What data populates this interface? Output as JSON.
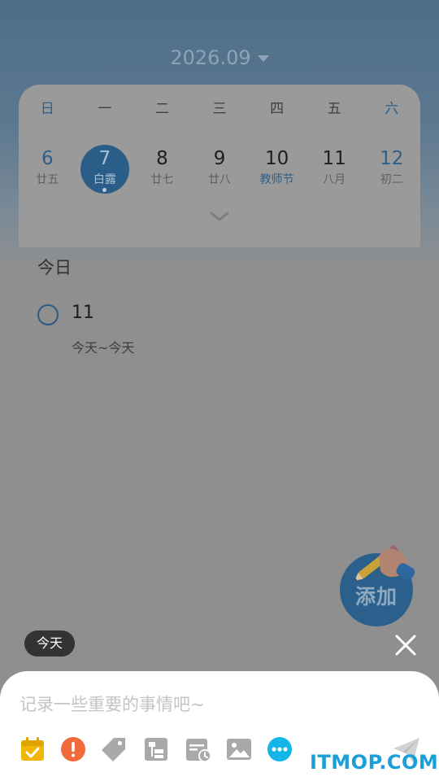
{
  "header": {
    "month": "2026.09"
  },
  "calendar": {
    "weekdays": [
      "日",
      "一",
      "二",
      "三",
      "四",
      "五",
      "六"
    ],
    "days": [
      {
        "num": "6",
        "lunar": "廿五"
      },
      {
        "num": "7",
        "lunar": "白露"
      },
      {
        "num": "8",
        "lunar": "廿七"
      },
      {
        "num": "9",
        "lunar": "廿八"
      },
      {
        "num": "10",
        "lunar": "教师节"
      },
      {
        "num": "11",
        "lunar": "八月"
      },
      {
        "num": "12",
        "lunar": "初二"
      }
    ]
  },
  "list": {
    "section_title": "今日",
    "task": {
      "title": "11",
      "range": "今天~今天"
    }
  },
  "fab": {
    "label": "添加"
  },
  "composer": {
    "date_chip": "今天",
    "placeholder": "记录一些重要的事情吧~",
    "tools": [
      "calendar-icon",
      "priority-icon",
      "tag-icon",
      "subtask-icon",
      "reminder-icon",
      "image-icon",
      "more-icon"
    ]
  },
  "watermark": "ITMOP.COM",
  "colors": {
    "accent": "#2b5f8c",
    "calendar_tool": "#f2b705",
    "priority_tool": "#f06a3a",
    "more_tool": "#14b6ea",
    "watermark": "#1a9fd9"
  }
}
